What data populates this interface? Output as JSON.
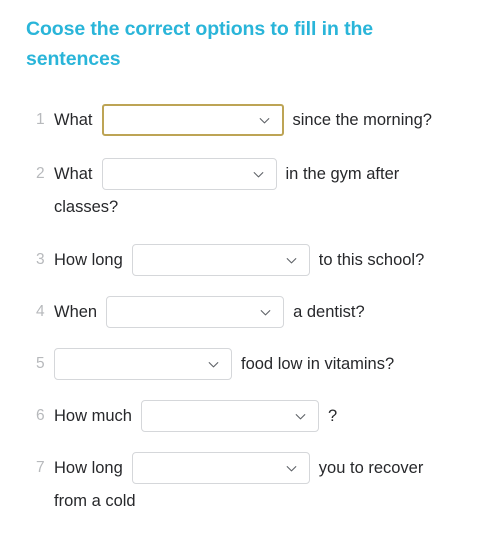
{
  "page": {
    "title": "Coose the correct options to fill in the sentences",
    "title_color": "#2ab5d9",
    "background_color": "#ffffff",
    "text_color": "#27282b",
    "number_color": "#b7b9bc",
    "select_border_color": "#d5d7da",
    "select_focus_border_color": "#bda455"
  },
  "questions": [
    {
      "number": "1",
      "lead_text": "What",
      "select_value": "",
      "trail_text": "since the morning?",
      "second_line": "",
      "focused": true,
      "dropdown_icon": "chevron-down-icon"
    },
    {
      "number": "2",
      "lead_text": "What",
      "select_value": "",
      "trail_text": "in the gym after",
      "second_line": "classes?",
      "focused": false,
      "dropdown_icon": "chevron-down-icon"
    },
    {
      "number": "3",
      "lead_text": "How long",
      "select_value": "",
      "trail_text": "to this school?",
      "second_line": "",
      "focused": false,
      "dropdown_icon": "chevron-down-icon"
    },
    {
      "number": "4",
      "lead_text": "When",
      "select_value": "",
      "trail_text": "a dentist?",
      "second_line": "",
      "focused": false,
      "dropdown_icon": "chevron-down-icon"
    },
    {
      "number": "5",
      "lead_text": "",
      "select_value": "",
      "trail_text": "food low in vitamins?",
      "second_line": "",
      "focused": false,
      "dropdown_icon": "chevron-down-icon"
    },
    {
      "number": "6",
      "lead_text": "How much",
      "select_value": "",
      "trail_text": "?",
      "second_line": "",
      "focused": false,
      "dropdown_icon": "chevron-down-icon"
    },
    {
      "number": "7",
      "lead_text": "How long",
      "select_value": "",
      "trail_text": "you to recover",
      "second_line": "from a cold",
      "focused": false,
      "dropdown_icon": "chevron-down-icon"
    }
  ]
}
